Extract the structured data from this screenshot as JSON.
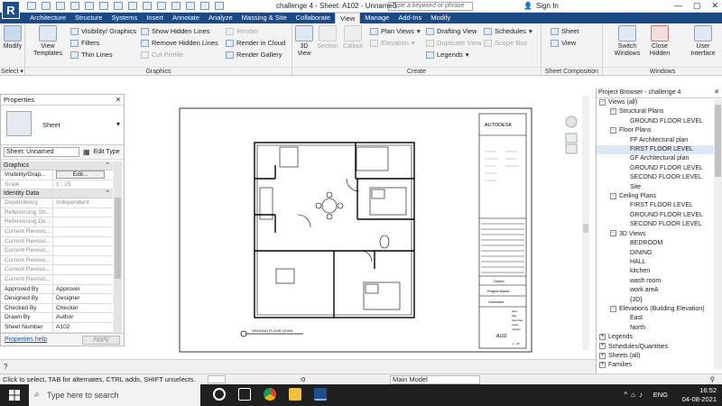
{
  "app": {
    "logo": "R",
    "title": "challenge 4 - Sheet: A102 - Unnamed",
    "search_placeholder": "Type a keyword or phrase",
    "sign_in": "Sign In"
  },
  "tabs": [
    "Architecture",
    "Structure",
    "Systems",
    "Insert",
    "Annotate",
    "Analyze",
    "Massing & Site",
    "Collaborate",
    "View",
    "Manage",
    "Add-Ins",
    "Modify"
  ],
  "active_tab": "View",
  "ribbon": {
    "select": {
      "modify": "Modify",
      "panel": "Select ▾"
    },
    "graphics": {
      "panel": "Graphics",
      "view_templates": "View Templates",
      "visibility": "Visibility/ Graphics",
      "filters": "Filters",
      "thin_lines": "Thin Lines",
      "show_hidden": "Show Hidden Lines",
      "remove_hidden": "Remove Hidden Lines",
      "cut_profile": "Cut Profile",
      "render": "Render",
      "render_cloud": "Render in Cloud",
      "render_gallery": "Render Gallery"
    },
    "create": {
      "panel": "Create",
      "view3d": "3D View",
      "section": "Section",
      "callout": "Callout",
      "plan_views": "Plan Views",
      "elevation": "Elevation",
      "drafting_view": "Drafting View",
      "duplicate_view": "Duplicate View",
      "legends": "Legends",
      "schedules": "Schedules",
      "scope_box": "Scope Box"
    },
    "sheet_comp": {
      "panel": "Sheet Composition",
      "sheet": "Sheet",
      "view": "View"
    },
    "windows": {
      "panel": "Windows",
      "switch": "Switch Windows",
      "close_hidden": "Close Hidden",
      "user_interface": "User Interface"
    }
  },
  "properties": {
    "title": "Properties",
    "type_name": "Sheet",
    "instance": "Sheet: Unnamed",
    "edit_type": "Edit Type",
    "rows": [
      {
        "cat": "Graphics"
      },
      {
        "k": "Visibility/Grap...",
        "v": "Edit...",
        "btn": true
      },
      {
        "k": "Scale",
        "v": "1 : 25",
        "g": true
      },
      {
        "cat": "Identity Data"
      },
      {
        "k": "Dependency",
        "v": "Independent",
        "g": true
      },
      {
        "k": "Referencing Sh...",
        "v": "",
        "g": true
      },
      {
        "k": "Referencing De...",
        "v": "",
        "g": true
      },
      {
        "k": "Current Revisio...",
        "v": "",
        "g": true
      },
      {
        "k": "Current Revisio...",
        "v": "",
        "g": true
      },
      {
        "k": "Current Revisio...",
        "v": "",
        "g": true
      },
      {
        "k": "Current Revisio...",
        "v": "",
        "g": true
      },
      {
        "k": "Current Revisio...",
        "v": "",
        "g": true
      },
      {
        "k": "Current Revisio...",
        "v": "",
        "g": true
      },
      {
        "k": "Approved By",
        "v": "Approver"
      },
      {
        "k": "Designed By",
        "v": "Designer"
      },
      {
        "k": "Checked By",
        "v": "Checker"
      },
      {
        "k": "Drawn By",
        "v": "Author"
      },
      {
        "k": "Sheet Number",
        "v": "A102"
      }
    ],
    "help": "Properties help",
    "apply": "Apply"
  },
  "sheet": {
    "title_block": {
      "brand": "AUTODESK",
      "owner": "Owner",
      "project": "Project Name",
      "unnamed": "Unnamed",
      "number": "A102",
      "scale": "1 : 25",
      "meta": [
        "0001",
        "Date",
        "Issue Date",
        "Author",
        "Checker"
      ]
    },
    "view_label": "GROUND FLOOR LEVEL"
  },
  "browser": {
    "title": "Project Browser - challenge 4",
    "tree": [
      {
        "label": "Views (all)",
        "lvl": 0,
        "exp": "-"
      },
      {
        "label": "Structural Plans",
        "lvl": 1,
        "exp": "-"
      },
      {
        "label": "GROUND FLOOR LEVEL",
        "lvl": 2
      },
      {
        "label": "Floor Plans",
        "lvl": 1,
        "exp": "-"
      },
      {
        "label": "FF Architectural plan",
        "lvl": 2
      },
      {
        "label": "FIRST FLOOR LEVEL",
        "lvl": 2,
        "sel": true
      },
      {
        "label": "GF Architectural plan",
        "lvl": 2
      },
      {
        "label": "GROUND FLOOR LEVEL",
        "lvl": 2
      },
      {
        "label": "SECOND FLOOR LEVEL",
        "lvl": 2
      },
      {
        "label": "Site",
        "lvl": 2
      },
      {
        "label": "Ceiling Plans",
        "lvl": 1,
        "exp": "-"
      },
      {
        "label": "FIRST FLOOR LEVEL",
        "lvl": 2
      },
      {
        "label": "GROUND FLOOR LEVEL",
        "lvl": 2
      },
      {
        "label": "SECOND FLOOR LEVEL",
        "lvl": 2
      },
      {
        "label": "3D Views",
        "lvl": 1,
        "exp": "-"
      },
      {
        "label": "BEDROOM",
        "lvl": 2
      },
      {
        "label": "DINING",
        "lvl": 2
      },
      {
        "label": "HALL",
        "lvl": 2
      },
      {
        "label": "kitchen",
        "lvl": 2
      },
      {
        "label": "wash room",
        "lvl": 2
      },
      {
        "label": "work areA",
        "lvl": 2
      },
      {
        "label": "{3D}",
        "lvl": 2
      },
      {
        "label": "Elevations (Building Elevation)",
        "lvl": 1,
        "exp": "-"
      },
      {
        "label": "East",
        "lvl": 2
      },
      {
        "label": "North",
        "lvl": 2
      },
      {
        "label": "Legends",
        "lvl": 0,
        "exp": "+"
      },
      {
        "label": "Schedules/Quantities",
        "lvl": 0,
        "exp": "+"
      },
      {
        "label": "Sheets (all)",
        "lvl": 0,
        "exp": "+"
      },
      {
        "label": "Families",
        "lvl": 0,
        "exp": "+"
      }
    ]
  },
  "status": {
    "text": "Click to select, TAB for alternates, CTRL adds, SHIFT unselects.",
    "model": "Main Model",
    "zero": ":0"
  },
  "taskbar": {
    "search": "Type here to search",
    "lang": "ENG",
    "time": "16:52",
    "date": "04-08-2021"
  },
  "colors": {
    "ribbon_tab": "#1a4a86",
    "taskbar": "#202020",
    "accent": "#1f4e8c"
  }
}
